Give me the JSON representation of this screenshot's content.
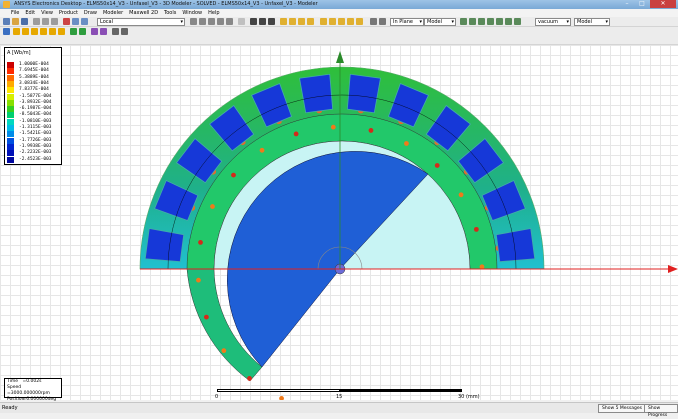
{
  "window": {
    "title": "ANSYS Electronics Desktop - ELMS50x14_V3 - Unfaxel_V3 - 3D Modeler - SOLVED - ELMS50x14_V3 - Unfaxel_V3 - Modeler"
  },
  "menu": [
    "File",
    "Edit",
    "View",
    "Product",
    "Draw",
    "Modeler",
    "Maxwell 2D",
    "Tools",
    "Window",
    "Help"
  ],
  "toolbar": {
    "coord_system": "Local",
    "plane": "In Plane",
    "model": "Model",
    "unit": "vacuum",
    "combo3": "Model"
  },
  "legend": {
    "title": "A [Wb/m]",
    "entries": [
      {
        "value": "1.0000E-004",
        "color": "#cc0000"
      },
      {
        "value": "7.6945E-004",
        "color": "#ff2a00"
      },
      {
        "value": "5.3889E-004",
        "color": "#ff6a00"
      },
      {
        "value": "3.0834E-004",
        "color": "#ffaa00"
      },
      {
        "value": "7.8377E-004",
        "color": "#ffe600"
      },
      {
        "value": "-1.5877E-004",
        "color": "#d8f000"
      },
      {
        "value": "-3.8932E-004",
        "color": "#88e000"
      },
      {
        "value": "-6.1987E-004",
        "color": "#36d020"
      },
      {
        "value": "-8.5043E-004",
        "color": "#00d070"
      },
      {
        "value": "-1.0810E-003",
        "color": "#00d8c0"
      },
      {
        "value": "-1.3115E-003",
        "color": "#00bce8"
      },
      {
        "value": "-1.5421E-003",
        "color": "#008ce8"
      },
      {
        "value": "-1.7726E-003",
        "color": "#0050e0"
      },
      {
        "value": "-1.9938E-003",
        "color": "#0024d0"
      },
      {
        "value": "-2.2232E-003",
        "color": "#0010b8"
      },
      {
        "value": "-2.4523E-003",
        "color": "#0008a0"
      }
    ]
  },
  "info": {
    "time_label": "Time",
    "time": "=0.002s",
    "speed_label": "Speed",
    "speed": "=3000.000000rpm",
    "position_label": "Position",
    "position": "=6.000000deg"
  },
  "scale": {
    "l0": "0",
    "l1": "15",
    "l2": "30 (mm)"
  },
  "status": {
    "ready": "Ready",
    "messages": "Show 5 Messages",
    "progress": "Show Progress"
  }
}
